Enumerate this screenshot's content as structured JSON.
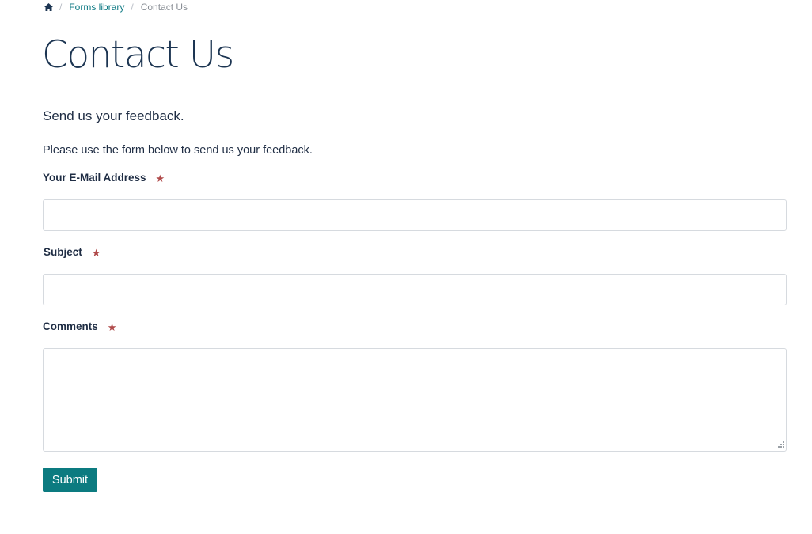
{
  "breadcrumb": {
    "home_icon": "home-icon",
    "separator": "/",
    "items": [
      {
        "label": "Forms library",
        "link": true
      },
      {
        "label": "Contact Us",
        "link": false
      }
    ]
  },
  "page": {
    "title": "Contact Us",
    "intro_heading": "Send us your feedback.",
    "intro_text": "Please use the form below to send us your feedback."
  },
  "form": {
    "required_marker": "★",
    "fields": [
      {
        "label": "Your E-Mail Address",
        "value": "",
        "required": true
      },
      {
        "label": "Subject",
        "value": "",
        "required": true
      },
      {
        "label": "Comments",
        "value": "",
        "required": true
      }
    ],
    "submit_label": "Submit"
  },
  "colors": {
    "title": "#1c3552",
    "text": "#1f2d44",
    "link": "#0f7a84",
    "required": "#b04a4a",
    "button": "#0c7b80",
    "input_border": "#d6dadf"
  }
}
